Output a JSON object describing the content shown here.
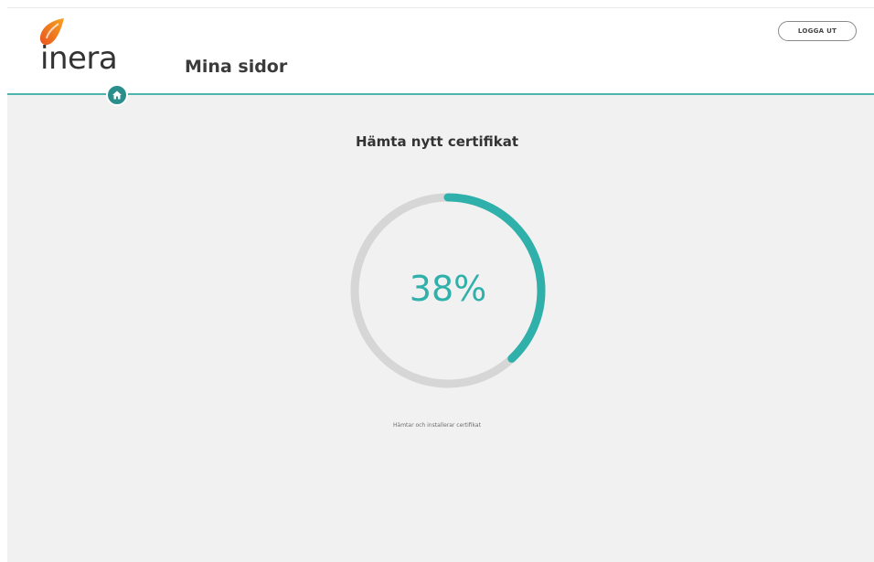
{
  "brand": {
    "logo_text": "inera",
    "logo_drop_colors": [
      "#e8551f",
      "#f39a1f"
    ]
  },
  "header": {
    "page_title": "Mina sidor",
    "logout_label": "LOGGA UT",
    "home_icon": "home-icon"
  },
  "main": {
    "section_title": "Hämta nytt certifikat",
    "progress": {
      "value": 38,
      "label": "38%"
    },
    "status_text": "Hämtar och installerar certifikat"
  },
  "colors": {
    "accent": "#2fb0aa",
    "track": "#d6d6d6",
    "background": "#f1f1f1",
    "header_line": "#4fb3b0"
  }
}
